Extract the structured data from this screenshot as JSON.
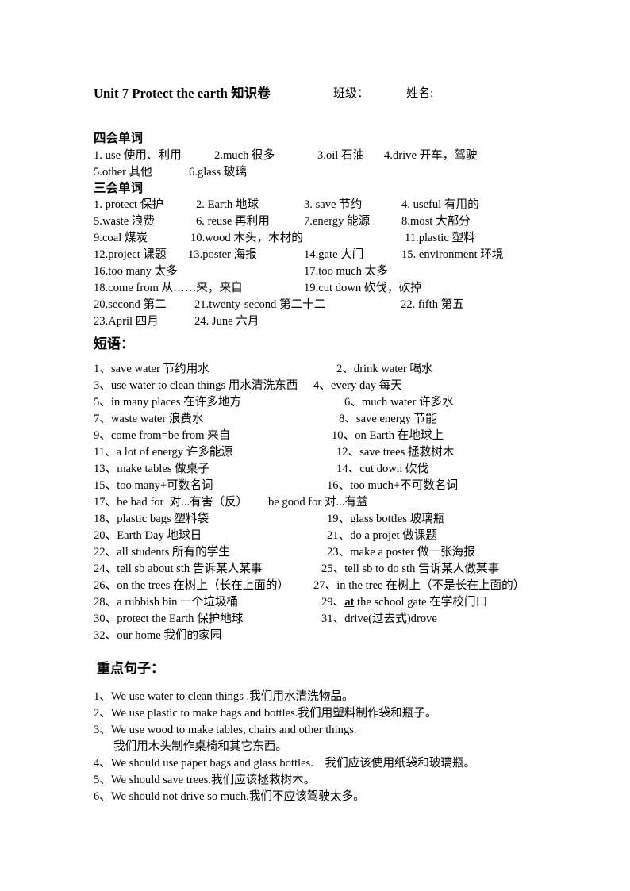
{
  "header": {
    "title": "Unit 7 Protect the earth 知识卷",
    "class_field": "班级：",
    "name_field": "姓名:"
  },
  "sections": {
    "four_skills": {
      "heading": "四会单词",
      "items": [
        {
          "n": "1. use ",
          "en": "use",
          "zh": "使用、利用"
        },
        {
          "n": "2.much ",
          "en": "much",
          "zh": "很多"
        },
        {
          "n": "3.oil ",
          "en": "oil",
          "zh": "石油"
        },
        {
          "n": "4.drive ",
          "en": "drive",
          "zh": "开车，驾驶"
        },
        {
          "n": "5.other ",
          "en": "other",
          "zh": "其他"
        },
        {
          "n": "6.glass ",
          "en": "glass",
          "zh": "玻璃"
        }
      ],
      "rows": [
        [
          "1. use 使用、利用",
          "2.much 很多",
          "3.oil 石油",
          "4.drive 开车，驾驶"
        ],
        [
          "5.other 其他",
          "6.glass 玻璃",
          "",
          ""
        ]
      ]
    },
    "three_skills": {
      "heading": "三会单词",
      "rows": [
        [
          "1. protect 保护",
          "2. Earth 地球",
          "3. save 节约",
          "4. useful 有用的"
        ],
        [
          "5.waste 浪费",
          "6. reuse 再利用",
          "7.energy 能源",
          "8.most 大部分"
        ],
        [
          "9.coal 煤炭",
          "10.wood 木头，木材的",
          "",
          "11.plastic 塑料"
        ],
        [
          "12.project 课题",
          "13.poster 海报",
          "14.gate 大门",
          "15. environment 环境"
        ],
        [
          "16.too many 太多",
          "",
          "17.too much 太多",
          ""
        ],
        [
          "18.come from 从……来，来自",
          "",
          "19.cut down 砍伐，砍掉",
          ""
        ],
        [
          "20.second 第二",
          "21.twenty-second 第二十二",
          "",
          "22. fifth 第五"
        ],
        [
          "23.April 四月",
          "24. June 六月",
          "",
          ""
        ]
      ]
    },
    "phrases": {
      "heading": "短语：",
      "items": [
        {
          "left": "1、save water 节约用水",
          "right": "2、drink water 喝水"
        },
        {
          "left": "3、use water to clean things 用水清洗东西",
          "right": "4、every day 每天",
          "tight": true
        },
        {
          "left": "5、in many places 在许多地方",
          "right": "6、much water 许多水"
        },
        {
          "left": "7、waste water 浪费水",
          "right": "8、save energy 节能"
        },
        {
          "left": "9、come from=be from 来自",
          "right": "10、on Earth 在地球上"
        },
        {
          "left": "11、a lot of energy 许多能源",
          "right": "12、save trees 拯救树木"
        },
        {
          "left": "13、make tables 做桌子",
          "right": "14、cut down 砍伐"
        },
        {
          "left": "15、too many+可数名词",
          "right": "16、too much+不可数名词"
        },
        {
          "left": "17、be bad for  对...有害（反）",
          "right": "be good for 对...有益",
          "tight": true
        },
        {
          "left": "18、plastic bags 塑料袋",
          "right": "19、glass bottles 玻璃瓶"
        },
        {
          "left": "20、Earth Day 地球日",
          "right": "21、do a projet 做课题"
        },
        {
          "left": "22、all students 所有的学生",
          "right": "23、make a poster 做一张海报"
        },
        {
          "left": "24、tell sb about sth 告诉某人某事",
          "right": "25、tell sb to do sth 告诉某人做某事"
        },
        {
          "left": "26、on the trees 在树上（长在上面的）",
          "right": "27、in the tree 在树上（不是长在上面的）",
          "tight": true
        },
        {
          "left": "28、a rubbish bin 一个垃圾桶",
          "right": "29、at the school gate 在学校门口",
          "right_underline_bold": "at"
        },
        {
          "left": "30、protect the Earth 保护地球",
          "right": "31、drive(过去式)drove"
        },
        {
          "left": "32、our home 我们的家园",
          "right": ""
        }
      ]
    },
    "sentences": {
      "heading": "重点句子：",
      "items": [
        {
          "num": "1、",
          "text": "We use water to clean things .我们用水清洗物品。",
          "cont": ""
        },
        {
          "num": "2、",
          "text": "We use plastic to make bags and bottles.我们用塑料制作袋和瓶子。",
          "cont": ""
        },
        {
          "num": "3、",
          "text": "We use wood to make tables, chairs and other things.",
          "cont": "我们用木头制作桌椅和其它东西。"
        },
        {
          "num": "4、",
          "text": "We should use paper bags and glass bottles.　我们应该使用纸袋和玻璃瓶。",
          "cont": ""
        },
        {
          "num": "5、",
          "text": "We should save trees.我们应该拯救树木。",
          "cont": ""
        },
        {
          "num": "6、",
          "text": "We should not drive so much.我们不应该驾驶太多。",
          "cont": ""
        }
      ]
    }
  }
}
